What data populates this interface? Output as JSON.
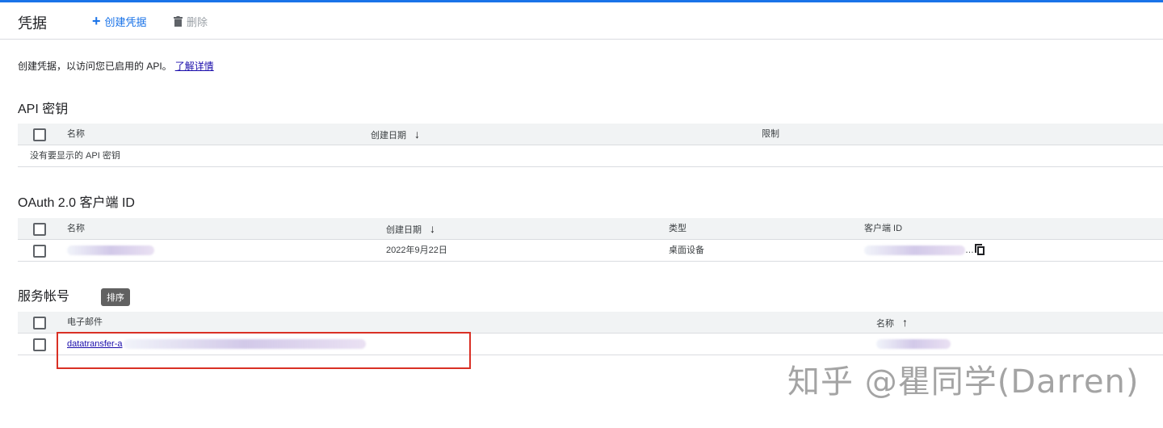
{
  "toolbar": {
    "title": "凭据",
    "create_label": "创建凭据",
    "delete_label": "删除",
    "create_icon": "plus-icon",
    "delete_icon": "trash-icon"
  },
  "intro": {
    "text": "创建凭据，以访问您已启用的 API。",
    "link": "了解详情"
  },
  "api_keys": {
    "title": "API 密钥",
    "columns": [
      "名称",
      "创建日期",
      "限制"
    ],
    "empty_text": "没有要显示的 API 密钥"
  },
  "oauth": {
    "title": "OAuth 2.0 客户端 ID",
    "columns": [
      "名称",
      "创建日期",
      "类型",
      "客户端 ID"
    ],
    "rows": [
      {
        "name": "",
        "date": "2022年9月22日",
        "type": "桌面设备",
        "client_id_visible": "…"
      }
    ]
  },
  "service_accounts": {
    "title": "服务帐号",
    "tooltip": "排序",
    "columns": [
      "电子邮件",
      "名称"
    ],
    "rows": [
      {
        "email_prefix": "datatransfer-a"
      }
    ]
  },
  "watermark": "知乎 @瞿同学(Darren)",
  "colors": {
    "accent": "#1a73e8",
    "highlight": "#d93025"
  }
}
